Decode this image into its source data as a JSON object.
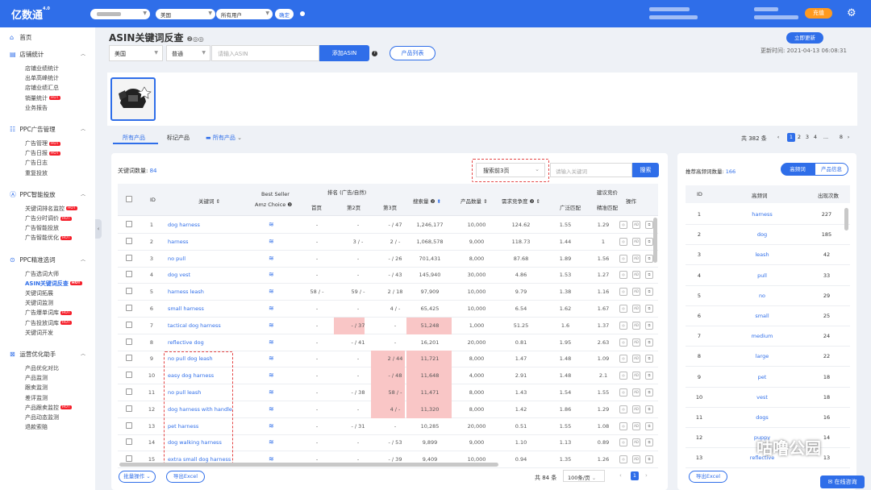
{
  "topbar": {
    "logo": "亿数通",
    "logo_ver": "4.0",
    "country": "美国",
    "user_filter": "所有用户",
    "confirm": "确定",
    "charge": "充值"
  },
  "sidebar": {
    "home": "首页",
    "groups": [
      {
        "label": "店铺统计",
        "items": [
          "店铺业绩统计",
          "出单高峰统计",
          "店铺业绩汇总",
          "销量统计",
          "业务报告"
        ],
        "hot": [
          3
        ]
      },
      {
        "label": "PPC广告管理",
        "items": [
          "广告管理",
          "广告日报",
          "广告日志",
          "重复投放"
        ],
        "hot": [
          0,
          1
        ]
      },
      {
        "label": "PPC智能投放",
        "items": [
          "关键词排名监控",
          "广告分时调价",
          "广告智能投放",
          "广告智能优化"
        ],
        "hot": [
          0,
          1,
          3
        ]
      },
      {
        "label": "PPC精准选词",
        "items": [
          "广告选词大师",
          "ASIN关键词反查",
          "关键词拓展",
          "关键词监测",
          "广告爆单词库",
          "广告投放词库",
          "关键词开发"
        ],
        "hot": [
          1,
          4,
          5
        ]
      },
      {
        "label": "运营优化助手",
        "items": [
          "产品优化对比",
          "产品监测",
          "跟卖监测",
          "差评监测",
          "产品跟卖监控",
          "产品动态监测",
          "退款索赔"
        ],
        "hot": [
          4
        ]
      }
    ],
    "hot_label": "HOT"
  },
  "header": {
    "title": "ASIN关键词反查",
    "update_btn": "立即更新",
    "update_time": "更新时间:  2021-04-13 06:08:31"
  },
  "query": {
    "country": "美国",
    "mode": "普通",
    "asin_placeholder": "请输入ASIN",
    "add_btn": "添加ASIN",
    "product_list": "产品列表"
  },
  "tabs": {
    "all": "所有产品",
    "marked": "标记产品",
    "folder": "所有产品"
  },
  "pagination_top": {
    "total": "共 382 条",
    "pages": [
      "1",
      "2",
      "3",
      "4",
      "...",
      "8"
    ]
  },
  "main": {
    "kw_count_label": "关键词数量:",
    "kw_count": "84",
    "range_select": "搜索前3页",
    "kw_placeholder": "请输入关键词",
    "search_btn": "搜索",
    "headers": {
      "id": "ID",
      "keyword": "关键词",
      "bs1": "Best Seller",
      "bs2": "Amz Choice",
      "rank": "排名 (广告/自然)",
      "p1": "首页",
      "p2": "第2页",
      "p3": "第3页",
      "volume": "搜索量",
      "count": "产品数量",
      "ratio": "需求竞争度",
      "bid": "建议竞价",
      "broad": "广泛匹配",
      "exact": "精准匹配",
      "ops": "操作"
    },
    "rows": [
      {
        "id": "1",
        "kw": "dog harness",
        "p1": "-",
        "p2": "-",
        "p3": "- / 47",
        "vol": "1,246,177",
        "cnt": "10,000",
        "ratio": "124.62",
        "broad": "1.55",
        "exact": "1.29"
      },
      {
        "id": "2",
        "kw": "harness",
        "p1": "-",
        "p2": "3 / -",
        "p3": "2 / -",
        "vol": "1,068,578",
        "cnt": "9,000",
        "ratio": "118.73",
        "broad": "1.44",
        "exact": "1"
      },
      {
        "id": "3",
        "kw": "no pull",
        "p1": "-",
        "p2": "-",
        "p3": "- / 26",
        "vol": "701,431",
        "cnt": "8,000",
        "ratio": "87.68",
        "broad": "1.89",
        "exact": "1.56"
      },
      {
        "id": "4",
        "kw": "dog vest",
        "p1": "-",
        "p2": "-",
        "p3": "- / 43",
        "vol": "145,940",
        "cnt": "30,000",
        "ratio": "4.86",
        "broad": "1.53",
        "exact": "1.27"
      },
      {
        "id": "5",
        "kw": "harness leash",
        "p1": "58 / -",
        "p2": "59 / -",
        "p3": "2 / 18",
        "vol": "97,909",
        "cnt": "10,000",
        "ratio": "9.79",
        "broad": "1.38",
        "exact": "1.16"
      },
      {
        "id": "6",
        "kw": "small harness",
        "p1": "-",
        "p2": "-",
        "p3": "4 / -",
        "vol": "65,425",
        "cnt": "10,000",
        "ratio": "6.54",
        "broad": "1.62",
        "exact": "1.67"
      },
      {
        "id": "7",
        "kw": "tactical dog harness",
        "p1": "-",
        "p2": "- / 37",
        "p3": "-",
        "vol": "51,248",
        "cnt": "1,000",
        "ratio": "51.25",
        "broad": "1.6",
        "exact": "1.37"
      },
      {
        "id": "8",
        "kw": "reflective dog",
        "p1": "-",
        "p2": "- / 41",
        "p3": "-",
        "vol": "16,201",
        "cnt": "20,000",
        "ratio": "0.81",
        "broad": "1.95",
        "exact": "2.63"
      },
      {
        "id": "9",
        "kw": "no pull dog leash",
        "p1": "-",
        "p2": "-",
        "p3": "2 / 44",
        "vol": "11,721",
        "cnt": "8,000",
        "ratio": "1.47",
        "broad": "1.48",
        "exact": "1.09"
      },
      {
        "id": "10",
        "kw": "easy dog harness",
        "p1": "-",
        "p2": "-",
        "p3": "- / 48",
        "vol": "11,648",
        "cnt": "4,000",
        "ratio": "2.91",
        "broad": "1.48",
        "exact": "2.1"
      },
      {
        "id": "11",
        "kw": "no pull leash",
        "p1": "-",
        "p2": "- / 38",
        "p3": "58 / -",
        "vol": "11,471",
        "cnt": "8,000",
        "ratio": "1.43",
        "broad": "1.54",
        "exact": "1.55"
      },
      {
        "id": "12",
        "kw": "dog harness with handle",
        "p1": "-",
        "p2": "-",
        "p3": "4 / -",
        "vol": "11,320",
        "cnt": "8,000",
        "ratio": "1.42",
        "broad": "1.86",
        "exact": "1.29"
      },
      {
        "id": "13",
        "kw": "pet harness",
        "p1": "-",
        "p2": "- / 31",
        "p3": "-",
        "vol": "10,285",
        "cnt": "20,000",
        "ratio": "0.51",
        "broad": "1.55",
        "exact": "1.08"
      },
      {
        "id": "14",
        "kw": "dog walking harness",
        "p1": "-",
        "p2": "-",
        "p3": "- / 53",
        "vol": "9,899",
        "cnt": "9,000",
        "ratio": "1.10",
        "broad": "1.13",
        "exact": "0.89"
      },
      {
        "id": "15",
        "kw": "extra small dog harness",
        "p1": "-",
        "p2": "-",
        "p3": "- / 39",
        "vol": "9,409",
        "cnt": "10,000",
        "ratio": "0.94",
        "broad": "1.35",
        "exact": "1.26"
      }
    ],
    "highlights": [
      [
        7,
        "p2"
      ],
      [
        7,
        "vol"
      ],
      [
        9,
        "p3"
      ],
      [
        9,
        "vol"
      ],
      [
        10,
        "p3"
      ],
      [
        10,
        "vol"
      ],
      [
        11,
        "p3"
      ],
      [
        11,
        "vol"
      ],
      [
        12,
        "p3"
      ],
      [
        12,
        "vol"
      ]
    ],
    "footer": {
      "batch": "批量操作",
      "export": "导出Excel",
      "total": "共 84 条",
      "per_page": "100条/页",
      "page": "1"
    }
  },
  "right": {
    "count_label": "推荐高频词数量:",
    "count": "166",
    "seg1": "高频词",
    "seg2": "产品信息",
    "headers": {
      "id": "ID",
      "word": "高频词",
      "times": "出现次数"
    },
    "rows": [
      [
        "1",
        "harness",
        "227"
      ],
      [
        "2",
        "dog",
        "185"
      ],
      [
        "3",
        "leash",
        "42"
      ],
      [
        "4",
        "pull",
        "33"
      ],
      [
        "5",
        "no",
        "29"
      ],
      [
        "6",
        "small",
        "25"
      ],
      [
        "7",
        "medium",
        "24"
      ],
      [
        "8",
        "large",
        "22"
      ],
      [
        "9",
        "pet",
        "18"
      ],
      [
        "10",
        "vest",
        "18"
      ],
      [
        "11",
        "dogs",
        "16"
      ],
      [
        "12",
        "puppy",
        "14"
      ],
      [
        "13",
        "reflective",
        "13"
      ]
    ],
    "export": "导出Excel"
  },
  "chat": "在线咨询",
  "watermark": "咕噜公园"
}
